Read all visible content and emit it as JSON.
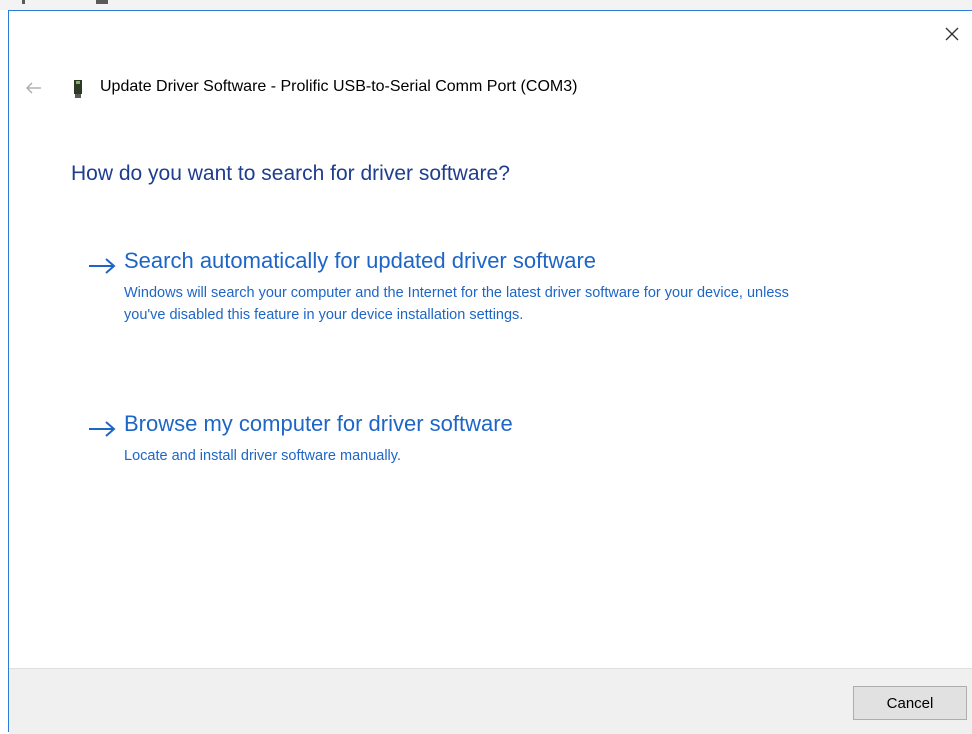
{
  "window": {
    "title": "Update Driver Software - Prolific USB-to-Serial Comm Port (COM3)",
    "close_icon": "close-icon",
    "back_icon": "back-arrow-icon",
    "device_icon": "usb-device-icon"
  },
  "main": {
    "heading": "How do you want to search for driver software?",
    "options": [
      {
        "title": "Search automatically for updated driver software",
        "description": "Windows will search your computer and the Internet for the latest driver software for your device, unless you've disabled this feature in your device installation settings.",
        "icon": "right-arrow-icon"
      },
      {
        "title": "Browse my computer for driver software",
        "description": "Locate and install driver software manually.",
        "icon": "right-arrow-icon"
      }
    ]
  },
  "footer": {
    "cancel_label": "Cancel"
  },
  "colors": {
    "link_blue": "#1e66c6",
    "heading_blue": "#1f3d8f",
    "window_border": "#2b79d8",
    "footer_bg": "#f0f0f0"
  }
}
